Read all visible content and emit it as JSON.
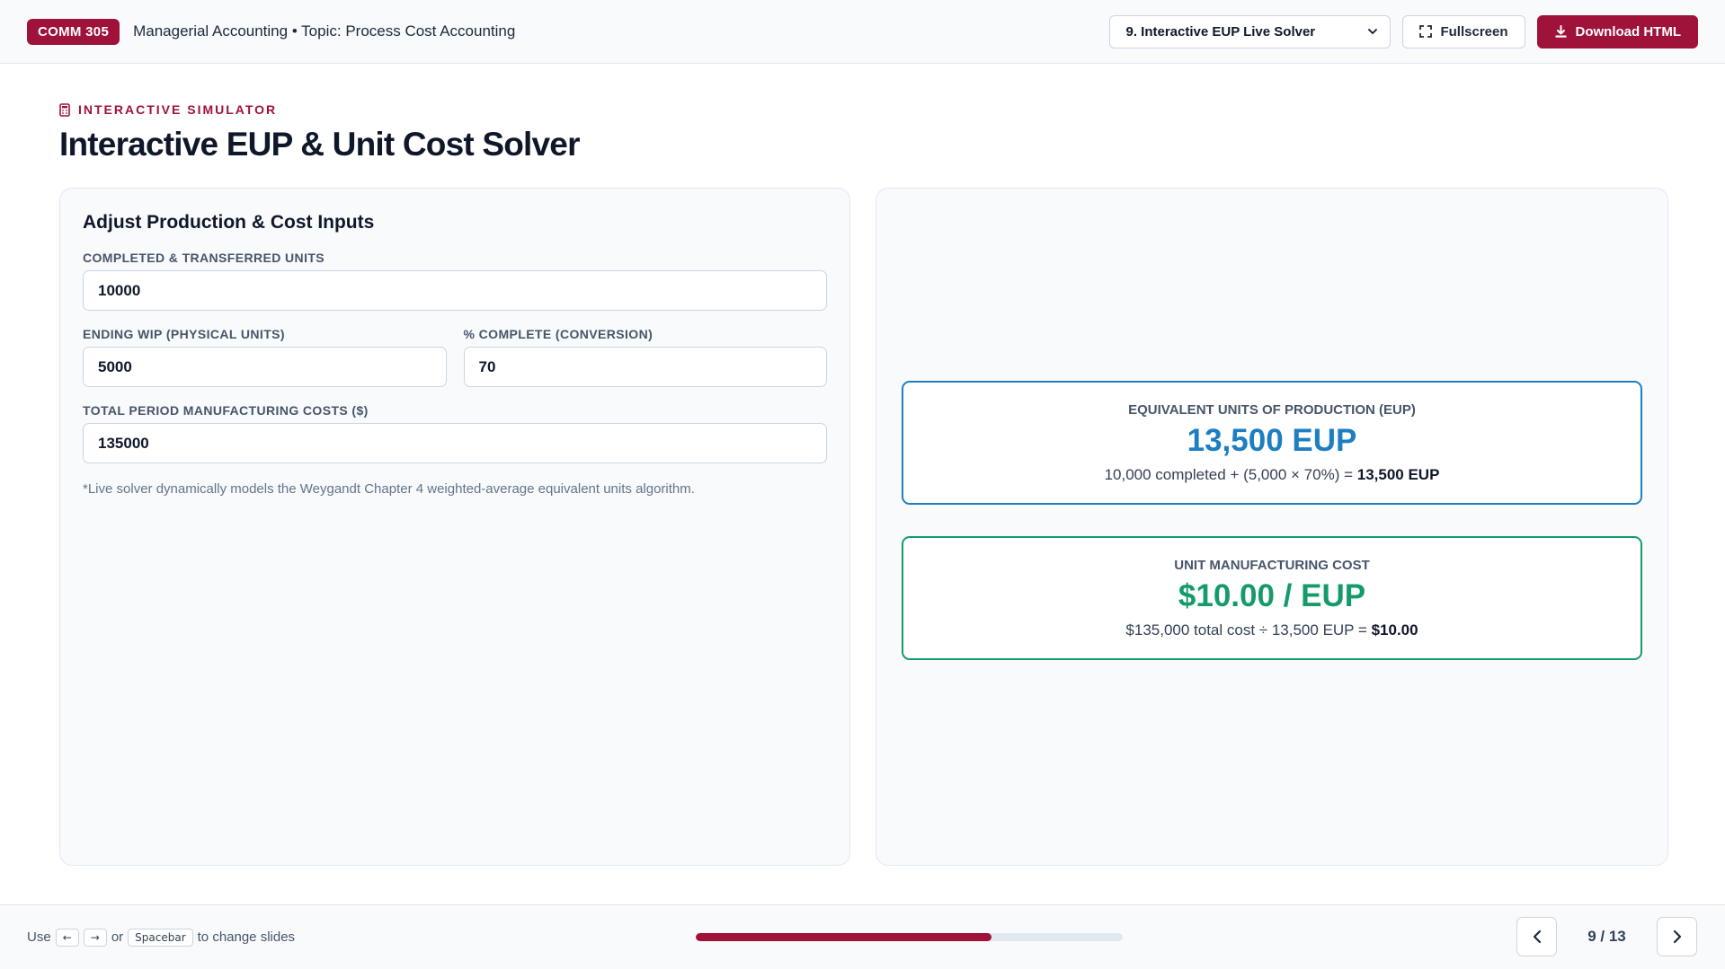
{
  "header": {
    "course_code": "COMM 305",
    "course_title": "Managerial Accounting • Topic: Process Cost Accounting",
    "slide_select_value": "9. Interactive EUP Live Solver",
    "fullscreen_label": "Fullscreen",
    "download_label": "Download HTML"
  },
  "slide": {
    "eyebrow": "INTERACTIVE SIMULATOR",
    "title": "Interactive EUP & Unit Cost Solver"
  },
  "inputs_panel": {
    "heading": "Adjust Production & Cost Inputs",
    "completed_label": "COMPLETED & TRANSFERRED UNITS",
    "completed_value": "10000",
    "ending_wip_label": "ENDING WIP (PHYSICAL UNITS)",
    "ending_wip_value": "5000",
    "percent_label": "% COMPLETE (CONVERSION)",
    "percent_value": "70",
    "total_cost_label": "TOTAL PERIOD MANUFACTURING COSTS ($)",
    "total_cost_value": "135000",
    "note": "*Live solver dynamically models the Weygandt Chapter 4 weighted-average equivalent units algorithm."
  },
  "results": {
    "eup": {
      "label": "EQUIVALENT UNITS OF PRODUCTION (EUP)",
      "value": "13,500 EUP",
      "formula": "10,000 completed + (5,000 × 70%) = ",
      "formula_result": "13,500 EUP"
    },
    "unit_cost": {
      "label": "UNIT MANUFACTURING COST",
      "value": "$10.00 / EUP",
      "formula": "$135,000 total cost ÷ 13,500 EUP = ",
      "formula_result": "$10.00"
    }
  },
  "footer": {
    "hint_use": "Use",
    "key_left": "←",
    "key_right": "→",
    "hint_or": "or",
    "key_space": "Spacebar",
    "hint_end": "to change slides",
    "progress_fraction": 0.692,
    "counter": "9 / 13"
  },
  "colors": {
    "brand": "#9f1239",
    "eup_accent": "#1d7fc2",
    "cost_accent": "#159b6a"
  },
  "icons": [
    "calculator-icon",
    "chevron-down-icon",
    "fullscreen-icon",
    "download-icon",
    "chevron-left-icon",
    "chevron-right-icon"
  ]
}
